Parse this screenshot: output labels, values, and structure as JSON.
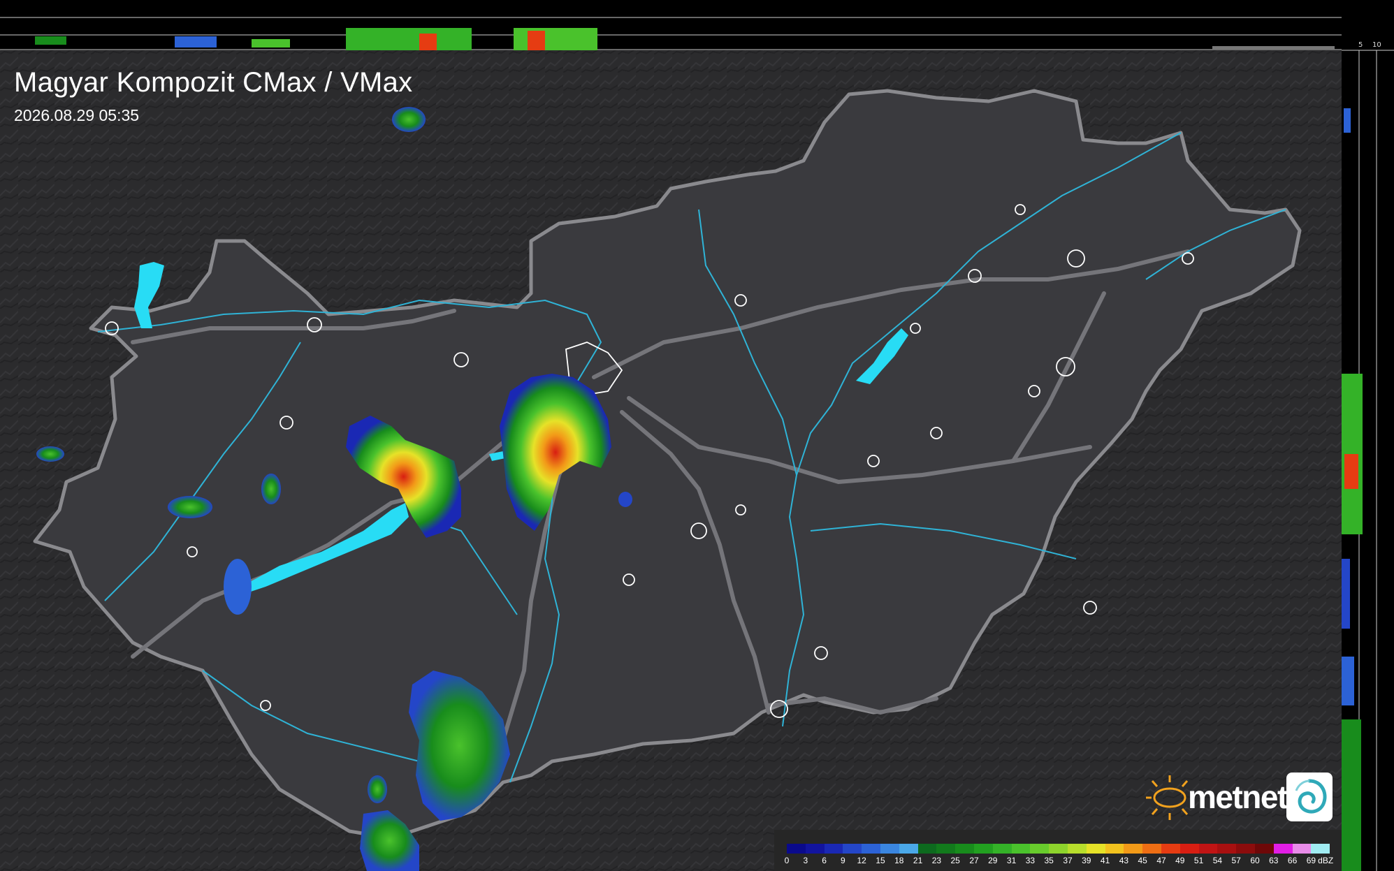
{
  "header": {
    "title": "Magyar Kompozit CMax / VMax",
    "timestamp": "2026.08.29 05:35"
  },
  "profile_scales": {
    "top": [
      "10",
      "5"
    ],
    "side": [
      "5",
      "10"
    ]
  },
  "logo": {
    "text": "metnet",
    "icons": [
      "sun-icon",
      "metnet-swirl-icon"
    ]
  },
  "legend": {
    "unit": "dBZ",
    "values": [
      "0",
      "3",
      "6",
      "9",
      "12",
      "15",
      "18",
      "21",
      "23",
      "25",
      "27",
      "29",
      "31",
      "33",
      "35",
      "37",
      "39",
      "41",
      "43",
      "45",
      "47",
      "49",
      "51",
      "54",
      "57",
      "60",
      "63",
      "66",
      "69"
    ],
    "colors": [
      "#0a0a8c",
      "#12149e",
      "#1a28b4",
      "#2446c8",
      "#2c62d6",
      "#3a86e0",
      "#4aa8e8",
      "#0d6a1e",
      "#127a1c",
      "#188c1c",
      "#22a020",
      "#34b228",
      "#4ac22c",
      "#68cc2c",
      "#8ed42c",
      "#b8de2c",
      "#e6e228",
      "#f2c21e",
      "#f29a18",
      "#ee6e14",
      "#e63c12",
      "#d81e12",
      "#c01414",
      "#a81010",
      "#8c0c0c",
      "#6e0808",
      "#e21ee6",
      "#e88ce8",
      "#a0ecf2"
    ]
  },
  "map": {
    "colors": {
      "background": "#2b2b2d",
      "country_fill": "#3a3a3e",
      "border": "#8a8a8e",
      "roads": "#75757a",
      "rivers": "#2fb3d6",
      "lakes": "#28dcf5",
      "city_outline": "#ffffff"
    }
  }
}
